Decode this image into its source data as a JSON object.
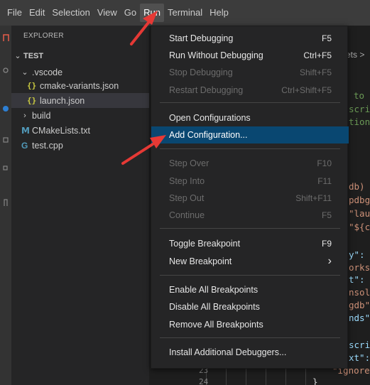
{
  "menubar": {
    "items": [
      {
        "label": "File"
      },
      {
        "label": "Edit"
      },
      {
        "label": "Selection"
      },
      {
        "label": "View"
      },
      {
        "label": "Go"
      },
      {
        "label": "Run"
      },
      {
        "label": "Terminal"
      },
      {
        "label": "Help"
      }
    ],
    "active": "Run"
  },
  "explorer": {
    "title": "EXPLORER",
    "root": "TEST",
    "vscode_folder": ".vscode",
    "files": {
      "cmake_variants": "cmake-variants.json",
      "launch": "launch.json",
      "build": "build",
      "cmakelists": "CMakeLists.txt",
      "test_cpp": "test.cpp"
    },
    "icons": {
      "json": "{}",
      "cmake": "M",
      "cpp": "G"
    }
  },
  "editor": {
    "breadcrumb": "ets >",
    "fragments": {
      "f1": "to",
      "f2": "scri",
      "f3": "tion",
      "f4": "db)",
      "f5": "pdbg",
      "f6": "\"lau",
      "f7": "\"${c",
      "f8": "y\": ",
      "f9": "orks",
      "f10": "t\":",
      "f11": "nsol",
      "f12": "gdb\"",
      "f13": "nds\"",
      "f14": "scri",
      "f15": "xt\":",
      "f16": "\"ignore",
      "f17": "}"
    },
    "line_numbers": [
      "23",
      "24"
    ]
  },
  "run_menu": {
    "items": [
      {
        "label": "Start Debugging",
        "shortcut": "F5",
        "enabled": true
      },
      {
        "label": "Run Without Debugging",
        "shortcut": "Ctrl+F5",
        "enabled": true
      },
      {
        "label": "Stop Debugging",
        "shortcut": "Shift+F5",
        "enabled": false
      },
      {
        "label": "Restart Debugging",
        "shortcut": "Ctrl+Shift+F5",
        "enabled": false
      },
      {
        "label": "Open Configurations",
        "shortcut": "",
        "enabled": true
      },
      {
        "label": "Add Configuration...",
        "shortcut": "",
        "enabled": true,
        "highlighted": true
      },
      {
        "label": "Step Over",
        "shortcut": "F10",
        "enabled": false
      },
      {
        "label": "Step Into",
        "shortcut": "F11",
        "enabled": false
      },
      {
        "label": "Step Out",
        "shortcut": "Shift+F11",
        "enabled": false
      },
      {
        "label": "Continue",
        "shortcut": "F5",
        "enabled": false
      },
      {
        "label": "Toggle Breakpoint",
        "shortcut": "F9",
        "enabled": true
      },
      {
        "label": "New Breakpoint",
        "shortcut": "›",
        "enabled": true
      },
      {
        "label": "Enable All Breakpoints",
        "shortcut": "",
        "enabled": true
      },
      {
        "label": "Disable All Breakpoints",
        "shortcut": "",
        "enabled": true
      },
      {
        "label": "Remove All Breakpoints",
        "shortcut": "",
        "enabled": true
      },
      {
        "label": "Install Additional Debuggers...",
        "shortcut": "",
        "enabled": true
      }
    ]
  },
  "colors": {
    "highlight": "#094771",
    "arrow": "#e53935",
    "json_icon": "#cbcb41",
    "cmake_icon": "#519aba"
  }
}
